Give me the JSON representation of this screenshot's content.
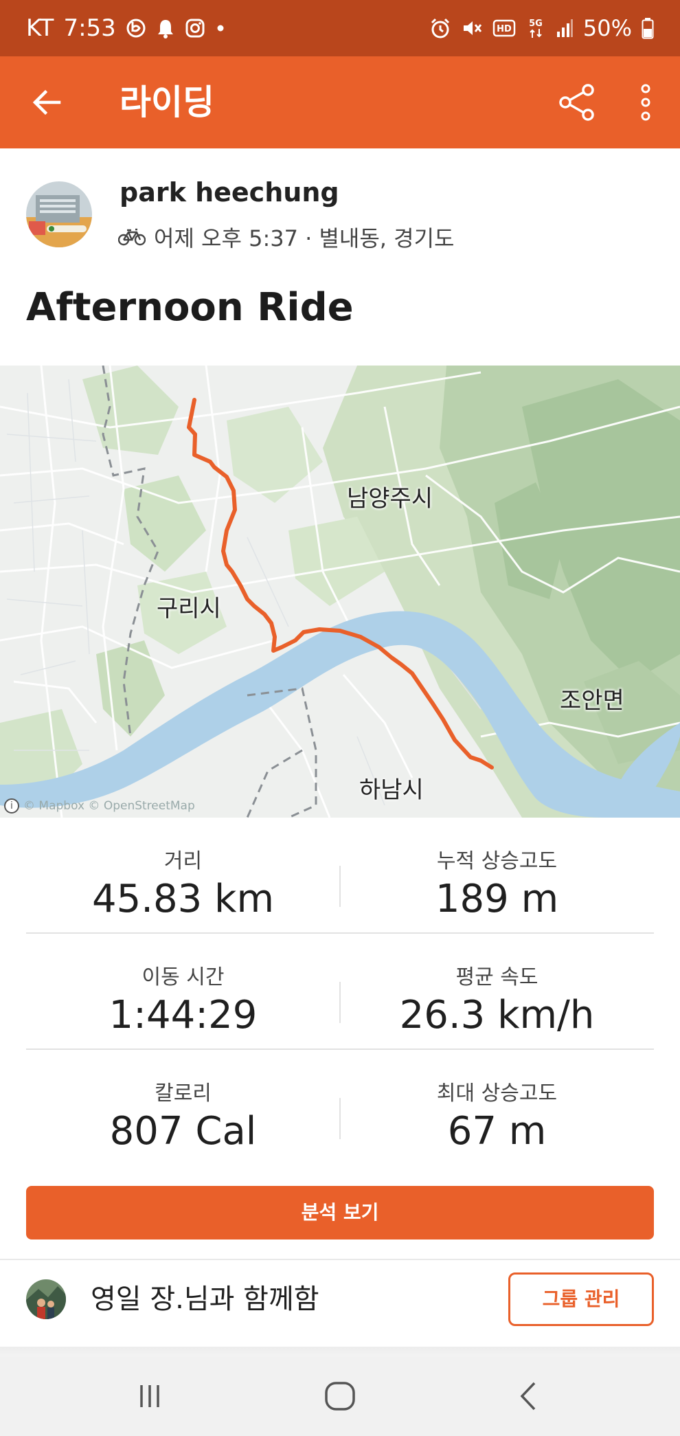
{
  "status_bar": {
    "carrier": "KT",
    "time": "7:53",
    "battery": "50%",
    "left_icons": [
      "b-app-icon",
      "bell-icon",
      "instagram-icon",
      "dot-icon"
    ],
    "right_icons": [
      "alarm-icon",
      "mute-icon",
      "hd-icon",
      "5g-icon",
      "signal-icon",
      "battery-icon"
    ]
  },
  "app_bar": {
    "title": "라이딩",
    "icons": [
      "back-arrow-icon",
      "share-icon",
      "more-vertical-icon"
    ]
  },
  "activity": {
    "athlete": "park heechung",
    "meta": "어제 오후 5:37 · 별내동, 경기도",
    "sport_icon": "bike-icon",
    "title": "Afternoon Ride"
  },
  "map": {
    "labels": [
      "남양주시",
      "구리시",
      "조안면",
      "하남시"
    ],
    "attribution": "© Mapbox © OpenStreetMap",
    "route_color": "#e9602a"
  },
  "stats": [
    {
      "label": "거리",
      "value": "45.83 km"
    },
    {
      "label": "누적 상승고도",
      "value": "189 m"
    },
    {
      "label": "이동 시간",
      "value": "1:44:29"
    },
    {
      "label": "평균 속도",
      "value": "26.3 km/h"
    },
    {
      "label": "칼로리",
      "value": "807 Cal"
    },
    {
      "label": "최대 상승고도",
      "value": "67 m"
    }
  ],
  "analysis_button": "분석 보기",
  "group": {
    "text": "영일 장.님과 함께함",
    "button": "그룹 관리"
  },
  "colors": {
    "accent": "#e9602a",
    "status_bar": "#b9461c"
  },
  "nav_bar": [
    "recent-apps-icon",
    "home-icon",
    "back-icon"
  ]
}
